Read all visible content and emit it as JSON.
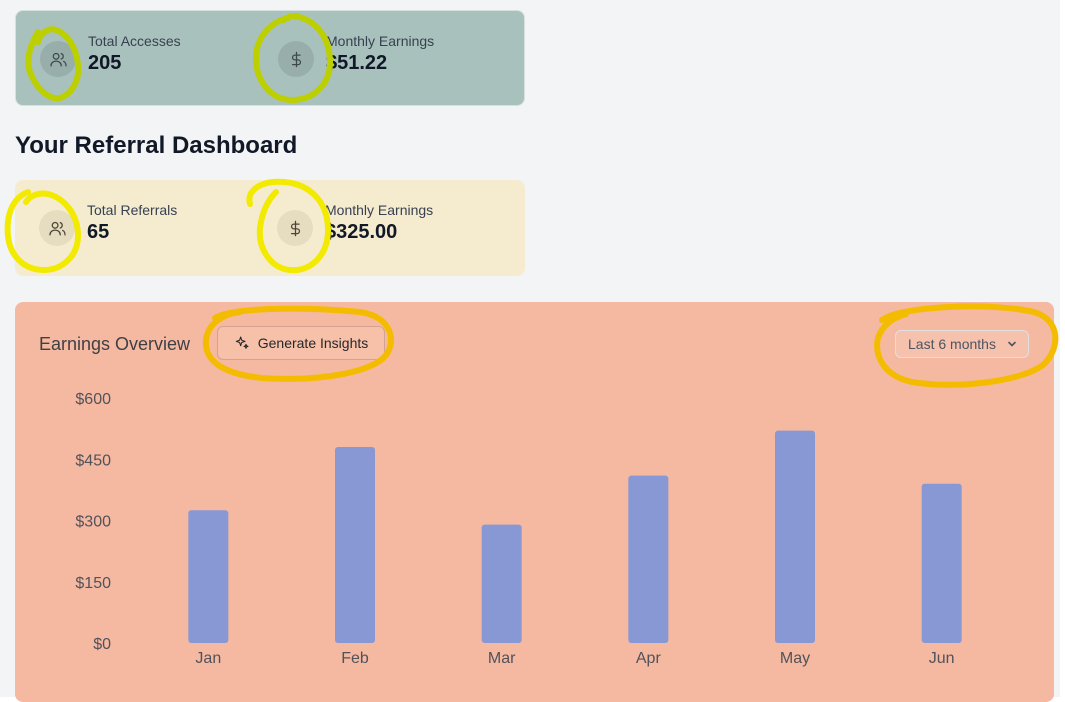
{
  "access_stats": {
    "total_label": "Total Accesses",
    "total_value": "205",
    "earnings_label": "Monthly Earnings",
    "earnings_value": "$51.22"
  },
  "section_title": "Your Referral Dashboard",
  "referral_stats": {
    "total_label": "Total Referrals",
    "total_value": "65",
    "earnings_label": "Monthly Earnings",
    "earnings_value": "$325.00"
  },
  "earnings_overview": {
    "title": "Earnings Overview",
    "insights_button": "Generate Insights",
    "range_select": "Last 6 months"
  },
  "icons": {
    "users": "users-icon",
    "dollar": "dollar-icon",
    "sparkles": "sparkles-icon",
    "chevron": "chevron-down-icon"
  },
  "colors": {
    "access_card": "#a9c1bd",
    "referral_card": "#f5ecd0",
    "chart_card": "#f4b9a0",
    "bar": "#8798d5",
    "highlight_green": "#bccf00",
    "highlight_yellow": "#f2ea00",
    "highlight_orange": "#f4bc00"
  },
  "chart_data": {
    "type": "bar",
    "categories": [
      "Jan",
      "Feb",
      "Mar",
      "Apr",
      "May",
      "Jun"
    ],
    "values": [
      325,
      480,
      290,
      410,
      520,
      390
    ],
    "y_ticks": [
      "$0",
      "$150",
      "$300",
      "$450",
      "$600"
    ],
    "ylim": [
      0,
      600
    ],
    "grid": false,
    "legend": "none"
  }
}
